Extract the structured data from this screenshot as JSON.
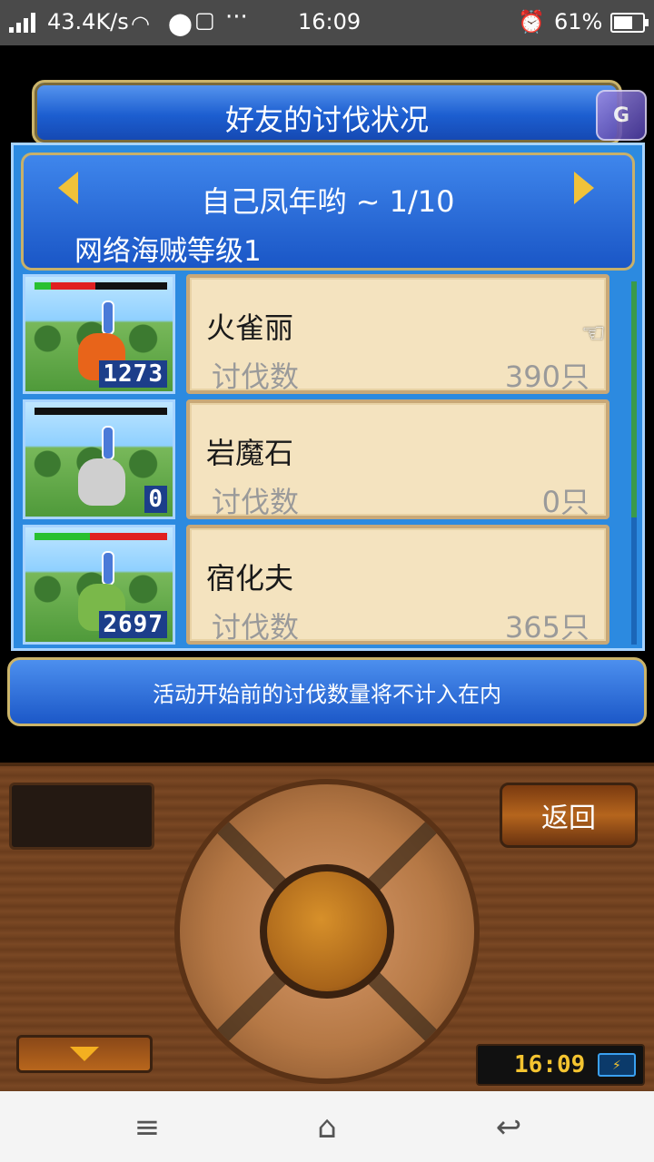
{
  "status_bar": {
    "speed": "43.4K/s",
    "time": "16:09",
    "battery": "61%",
    "dots": "···"
  },
  "title": "好友的讨伐状况",
  "badge": "G",
  "header": {
    "name": "自己凤年哟 ~ 1/10",
    "subtitle": "网络海贼等级1"
  },
  "monsters": [
    {
      "name": "火雀丽",
      "label": "讨伐数",
      "count": "390只",
      "level": "1273",
      "hp_green": 0.12,
      "hp_red": 0.34,
      "color": "#e8641a"
    },
    {
      "name": "岩魔石",
      "label": "讨伐数",
      "count": "0只",
      "level": "0",
      "hp_green": 0,
      "hp_red": 0,
      "color": "#cfcfcf"
    },
    {
      "name": "宿化夫",
      "label": "讨伐数",
      "count": "365只",
      "level": "2697",
      "hp_green": 0.42,
      "hp_red": 0.58,
      "color": "#7ab84a"
    }
  ],
  "notice": "活动开始前的讨伐数量将不计入在内",
  "controller": {
    "back_label": "返回",
    "clock": "16:09"
  },
  "colors": {
    "panel_blue": "#2c8ae0",
    "card_bg": "#f4e3bf",
    "gold": "#cbb46a"
  }
}
